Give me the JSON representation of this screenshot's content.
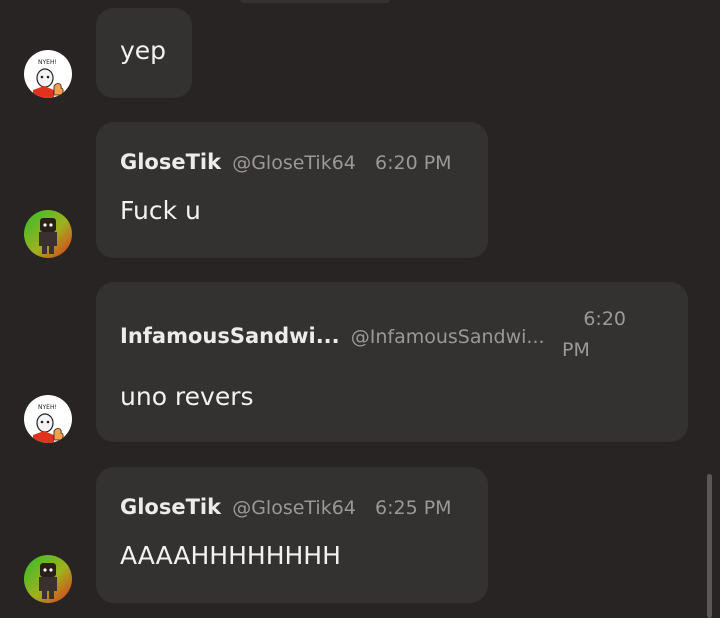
{
  "messages": [
    {
      "avatar": "papyrus-avatar",
      "name": "",
      "handle": "",
      "time": "",
      "text": "yep"
    },
    {
      "avatar": "glosetik-avatar",
      "name": "GloseTik",
      "handle": "@GloseTik64",
      "time": "6:20 PM",
      "text": "Fuck u"
    },
    {
      "avatar": "papyrus-avatar",
      "name": "InfamousSandwi...",
      "handle": "@InfamousSandwi...",
      "time_line1": "6:20",
      "time_line2": "PM",
      "text": "uno revers"
    },
    {
      "avatar": "glosetik-avatar",
      "name": "GloseTik",
      "handle": "@GloseTik64",
      "time": "6:25 PM",
      "text": "AAAAHHHHHHHH"
    }
  ],
  "avatar_text": "NYEH!",
  "colors": {
    "background": "#282423",
    "bubble": "#343131",
    "name": "#ececec",
    "meta": "#9c9897",
    "message_text": "#f2f2f2",
    "glosetik_gradient_start": "#2fbf2a",
    "glosetik_gradient_end": "#e0321d"
  }
}
